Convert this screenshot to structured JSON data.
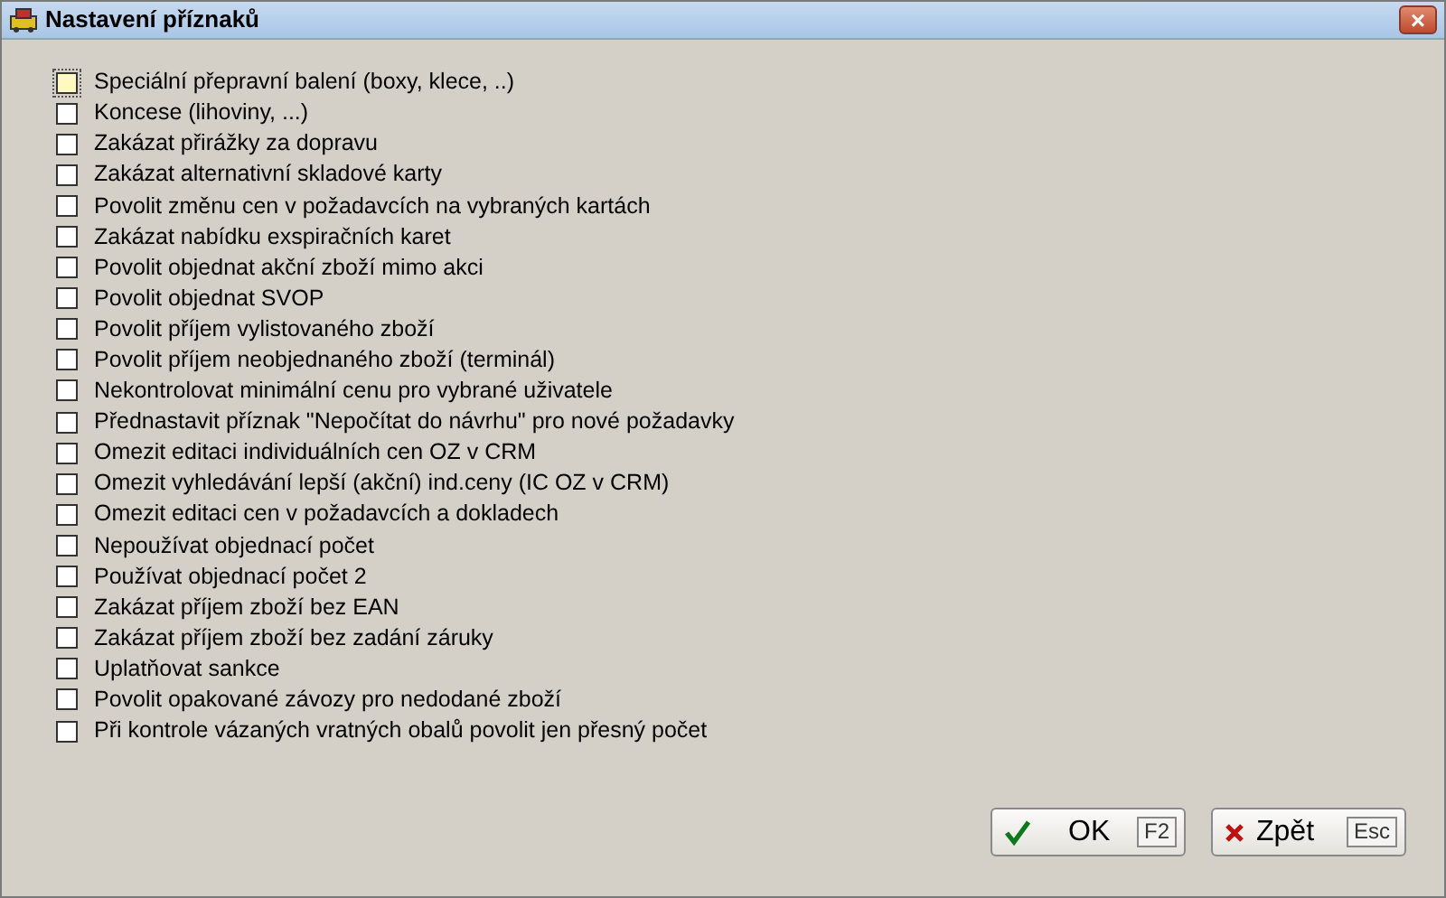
{
  "window": {
    "title": "Nastavení příznaků",
    "close_symbol": "×"
  },
  "options": [
    {
      "label": "Speciální přepravní balení (boxy, klece, ..)",
      "checked": false,
      "focused": true
    },
    {
      "label": "Koncese (lihoviny, ...)",
      "checked": false,
      "focused": false
    },
    {
      "label": "Zakázat přirážky za dopravu",
      "checked": false,
      "focused": false
    },
    {
      "label": "Zakázat alternativní skladové karty",
      "checked": false,
      "focused": false
    },
    {
      "label": "Povolit změnu cen v požadavcích na vybraných kartách",
      "checked": false,
      "focused": false
    },
    {
      "label": "Zakázat nabídku exspiračních karet",
      "checked": false,
      "focused": false
    },
    {
      "label": "Povolit objednat akční zboží mimo akci",
      "checked": false,
      "focused": false
    },
    {
      "label": "Povolit objednat SVOP",
      "checked": false,
      "focused": false
    },
    {
      "label": "Povolit příjem vylistovaného zboží",
      "checked": false,
      "focused": false
    },
    {
      "label": "Povolit příjem neobjednaného zboží (terminál)",
      "checked": false,
      "focused": false
    },
    {
      "label": "Nekontrolovat minimální cenu pro vybrané uživatele",
      "checked": false,
      "focused": false
    },
    {
      "label": "Přednastavit příznak \"Nepočítat do návrhu\" pro nové požadavky",
      "checked": false,
      "focused": false
    },
    {
      "label": "Omezit editaci individuálních cen OZ v CRM",
      "checked": false,
      "focused": false
    },
    {
      "label": "Omezit vyhledávání lepší (akční) ind.ceny (IC OZ v CRM)",
      "checked": false,
      "focused": false
    },
    {
      "label": "Omezit editaci cen v požadavcích a dokladech",
      "checked": false,
      "focused": false
    },
    {
      "label": "Nepoužívat objednací počet",
      "checked": false,
      "focused": false
    },
    {
      "label": "Používat objednací počet 2",
      "checked": false,
      "focused": false
    },
    {
      "label": "Zakázat příjem zboží bez EAN",
      "checked": false,
      "focused": false
    },
    {
      "label": "Zakázat příjem zboží bez zadání záruky",
      "checked": false,
      "focused": false
    },
    {
      "label": "Uplatňovat sankce",
      "checked": false,
      "focused": false
    },
    {
      "label": "Povolit opakované závozy pro nedodané zboží",
      "checked": false,
      "focused": false
    },
    {
      "label": "Při kontrole vázaných vratných obalů povolit jen přesný počet",
      "checked": false,
      "focused": false
    }
  ],
  "buttons": [
    {
      "kind": "ok",
      "label": "OK",
      "shortcut": "F2"
    },
    {
      "kind": "cancel",
      "label": "Zpět",
      "shortcut": "Esc"
    }
  ]
}
